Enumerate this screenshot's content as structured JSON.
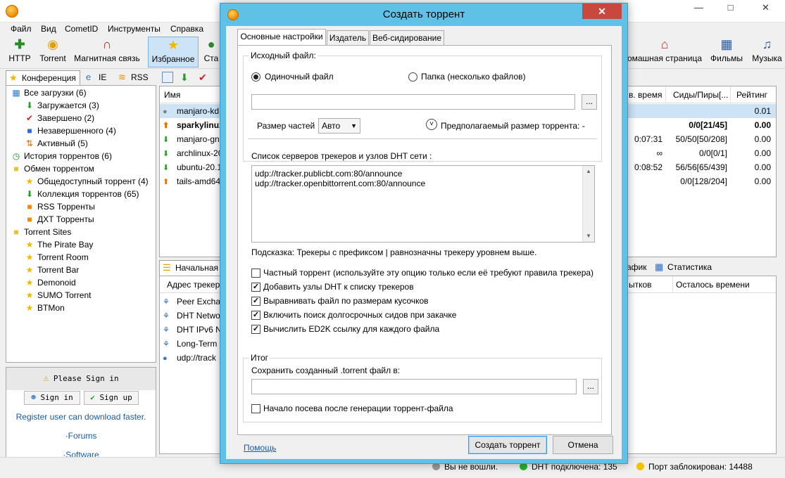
{
  "main_window": {
    "menu": [
      "Файл",
      "Вид",
      "CometID",
      "Инструменты",
      "Справка"
    ],
    "toolbar": [
      {
        "label": "HTTP",
        "icon": "plus-icon"
      },
      {
        "label": "Torrent",
        "icon": "torrent-icon"
      },
      {
        "label": "Магнитная связь",
        "icon": "magnet-icon"
      },
      {
        "label": "Избранное",
        "icon": "star-icon"
      },
      {
        "label": "Ста",
        "icon": "start-icon"
      },
      {
        "label": "омашная страница",
        "icon": "home-icon"
      },
      {
        "label": "Фильмы",
        "icon": "film-icon"
      },
      {
        "label": "Музыка",
        "icon": "music-icon"
      }
    ],
    "left_tabs": [
      "Конференция",
      "IE",
      "RSS"
    ],
    "tree": [
      {
        "label": "Все загрузки (6)",
        "level": 0,
        "icon": "all-downloads-icon"
      },
      {
        "label": "Загружается (3)",
        "level": 1,
        "icon": "download-arrow-icon"
      },
      {
        "label": "Завершено (2)",
        "level": 1,
        "icon": "check-icon"
      },
      {
        "label": "Незавершенного (4)",
        "level": 1,
        "icon": "incomplete-icon"
      },
      {
        "label": "Активный (5)",
        "level": 1,
        "icon": "active-icon"
      },
      {
        "label": "История торрентов (6)",
        "level": 0,
        "icon": "history-icon"
      },
      {
        "label": "Обмен торрентом",
        "level": 0,
        "icon": "folder-icon"
      },
      {
        "label": "Общедоступный торрент (4)",
        "level": 1,
        "icon": "public-torrent-icon"
      },
      {
        "label": "Коллекция торрентов (65)",
        "level": 1,
        "icon": "collection-icon"
      },
      {
        "label": "RSS Торренты",
        "level": 1,
        "icon": "rss-icon"
      },
      {
        "label": "ДХТ Торренты",
        "level": 1,
        "icon": "dht-icon"
      },
      {
        "label": "Torrent Sites",
        "level": 0,
        "icon": "folder-icon"
      },
      {
        "label": "The Pirate Bay",
        "level": 1,
        "icon": "site-icon"
      },
      {
        "label": "Torrent Room",
        "level": 1,
        "icon": "site-icon"
      },
      {
        "label": "Torrent Bar",
        "level": 1,
        "icon": "site-icon"
      },
      {
        "label": "Demonoid",
        "level": 1,
        "icon": "site-icon"
      },
      {
        "label": "SUMO Torrent",
        "level": 1,
        "icon": "site-icon"
      },
      {
        "label": "BTMon",
        "level": 1,
        "icon": "site-icon"
      }
    ],
    "signin": {
      "prompt": "Please Sign in",
      "sign_in": "Sign in",
      "sign_up": "Sign up",
      "register_note": "Register user can download faster.",
      "forums": "·Forums",
      "software": "·Software"
    },
    "list": {
      "header_name": "Имя",
      "rows": [
        {
          "name": "manjaro-kd",
          "icon": "paused-icon"
        },
        {
          "name": "sparkylinux",
          "icon": "upload-arrow-icon"
        },
        {
          "name": "manjaro-gn",
          "icon": "download-arrow-icon"
        },
        {
          "name": "archlinux-20",
          "icon": "download-arrow-icon"
        },
        {
          "name": "ubuntu-20.1",
          "icon": "download-arrow-icon"
        },
        {
          "name": "tails-amd64",
          "icon": "upload-arrow-icon"
        }
      ],
      "right_headers": [
        "в. время",
        "Сиды/Пиры[...",
        "Рейтинг"
      ],
      "right_rows": [
        [
          "",
          "",
          "0.01"
        ],
        [
          "",
          "0/0[21/45]",
          "0.00"
        ],
        [
          "0:07:31",
          "50/50[50/208]",
          "0.00"
        ],
        [
          "∞",
          "0/0[0/1]",
          "0.00"
        ],
        [
          "0:08:52",
          "56/56[65/439]",
          "0.00"
        ],
        [
          "",
          "0/0[128/204]",
          "0.00"
        ]
      ]
    },
    "bottom": {
      "left_tab": "Начальная",
      "tracker_header": "Адрес трекера",
      "trackers": [
        {
          "label": "Peer Exchan",
          "icon": "network-icon"
        },
        {
          "label": "DHT Netwo",
          "icon": "network-icon"
        },
        {
          "label": "DHT IPv6 N",
          "icon": "network-icon"
        },
        {
          "label": "Long-Term",
          "icon": "network-icon"
        },
        {
          "label": "udp://track",
          "icon": "globe-icon"
        }
      ],
      "right_tabs": [
        "афик",
        "Статистика"
      ],
      "right_headers": [
        "ытков",
        "Осталось времени"
      ]
    },
    "status": {
      "not_logged": "Вы не вошли.",
      "dht": "DHT подключена: 135",
      "port": "Порт заблокирован: 14488"
    },
    "colors": {
      "accent": "#5fc1e6",
      "close": "#c9483d",
      "selection": "#cde4f7"
    }
  },
  "dialog": {
    "title": "Создать торрент",
    "tabs": [
      "Основные настройки",
      "Издатель",
      "Веб-сидирование"
    ],
    "source_group": "Исходный файл:",
    "radio_single": "Одиночный файл",
    "radio_folder": "Папка (несколько файлов)",
    "source_path": "",
    "browse": "...",
    "piece_size_label": "Размер частей",
    "piece_size_value": "Авто",
    "estimated_size": "Предполагаемый размер торрента: -",
    "trackers_label": "Список серверов трекеров и узлов DHT сети :",
    "trackers": [
      "udp://tracker.publicbt.com:80/announce",
      "udp://tracker.openbittorrent.com:80/announce"
    ],
    "hint": "Подсказка: Трекеры с префиксом | равнозначны трекеру уровнем выше.",
    "options": [
      {
        "label": "Частный торрент (используйте эту опцию только если её требуют правила трекера)",
        "checked": false
      },
      {
        "label": "Добавить узлы DHT к списку трекеров",
        "checked": true
      },
      {
        "label": "Выравнивать файл по размерам кусочков",
        "checked": true
      },
      {
        "label": "Включить поиск долгосрочных сидов при закачке",
        "checked": true
      },
      {
        "label": "Вычислить ED2K ссылку для каждого файла",
        "checked": true
      }
    ],
    "result_group": "Итог",
    "save_label": "Сохранить созданный .torrent файл  в:",
    "save_path": "",
    "seed_after": "Начало посева после генерации торрент-файла",
    "help": "Помощь",
    "create": "Создать торрент",
    "cancel": "Отмена"
  }
}
